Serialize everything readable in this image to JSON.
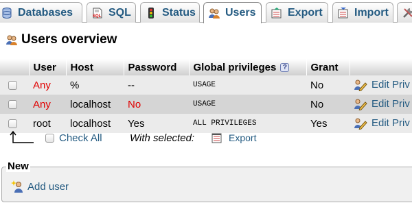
{
  "tabs": [
    {
      "label": "Databases",
      "icon": "database-icon",
      "active": false
    },
    {
      "label": "SQL",
      "icon": "sql-icon",
      "active": false
    },
    {
      "label": "Status",
      "icon": "traffic-light-icon",
      "active": false
    },
    {
      "label": "Users",
      "icon": "users-icon",
      "active": true
    },
    {
      "label": "Export",
      "icon": "export-icon",
      "active": false
    },
    {
      "label": "Import",
      "icon": "import-icon",
      "active": false
    },
    {
      "label": "",
      "icon": "settings-icon",
      "active": false
    }
  ],
  "heading": {
    "title": "Users overview",
    "icon": "users-icon"
  },
  "table": {
    "columns": [
      "",
      "User",
      "Host",
      "Password",
      "Global privileges",
      "Grant",
      ""
    ],
    "rows": [
      {
        "user": "Any",
        "host": "%",
        "password": "--",
        "privileges": "USAGE",
        "grant": "No",
        "action": "Edit Priv"
      },
      {
        "user": "Any",
        "host": "localhost",
        "password": "No",
        "privileges": "USAGE",
        "grant": "No",
        "action": "Edit Priv"
      },
      {
        "user": "root",
        "host": "localhost",
        "password": "Yes",
        "privileges": "ALL PRIVILEGES",
        "grant": "Yes",
        "action": "Edit Priv"
      }
    ]
  },
  "selection": {
    "check_all": "Check All",
    "with_selected": "With selected:",
    "export": "Export"
  },
  "new_section": {
    "legend": "New",
    "add_user": "Add user"
  },
  "colors": {
    "link": "#235a81",
    "warning": "#e00000",
    "row_odd": "#ebebeb",
    "row_even": "#d5d5d5"
  }
}
